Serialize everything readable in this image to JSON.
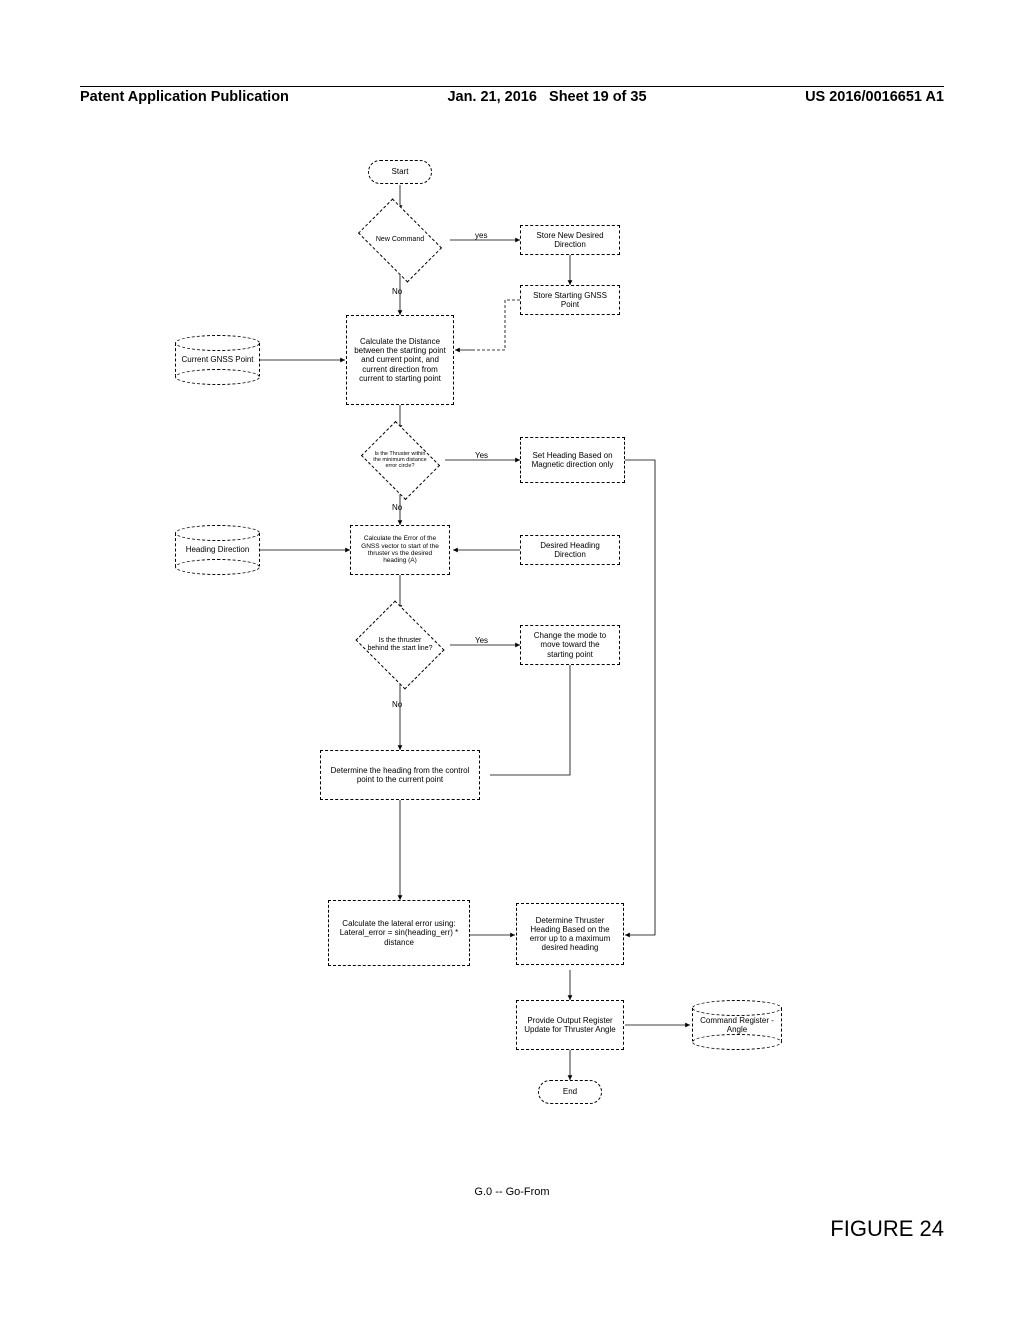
{
  "header": {
    "pub_label": "Patent Application Publication",
    "date": "Jan. 21, 2016",
    "sheet": "Sheet 19 of 35",
    "pub_number": "US 2016/0016651 A1"
  },
  "caption": "G.0 -- Go-From",
  "figure_label": "FIGURE 24",
  "labels": {
    "yes": "yes",
    "Yes": "Yes",
    "no": "No"
  },
  "shapes": {
    "start": "Start",
    "end": "End",
    "dec_newcmd": "New Command",
    "dec_thruster_circle": "Is the Thruster within the minimum distance error circle?",
    "dec_behind": "Is the thruster behind the start line?",
    "proc_store_dir": "Store New Desired Direction",
    "proc_store_gnss": "Store Starting GNSS Point",
    "proc_calc_dist": "Calculate the Distance between the starting point and current point, and current direction from current to starting point",
    "proc_set_heading": "Set Heading Based on Magnetic direction only",
    "proc_calc_err": "Calculate the Error of the GNSS vector to start of the thruster vs the desired heading (A)",
    "proc_desired_heading": "Desired Heading Direction",
    "proc_change_mode": "Change the mode to move toward the starting point",
    "proc_det_heading": "Determine the heading from the control point to the current point",
    "proc_lateral": "Calculate the lateral error using:\nLateral_error = sin(heading_err) * distance",
    "proc_thruster_heading": "Determine Thruster Heading Based on the error up to a maximum desired heading",
    "proc_output": "Provide Output Register Update for Thruster Angle",
    "db_gnss": "Current GNSS Point",
    "db_heading": "Heading Direction",
    "db_cmd": "Command Register - Angle"
  }
}
